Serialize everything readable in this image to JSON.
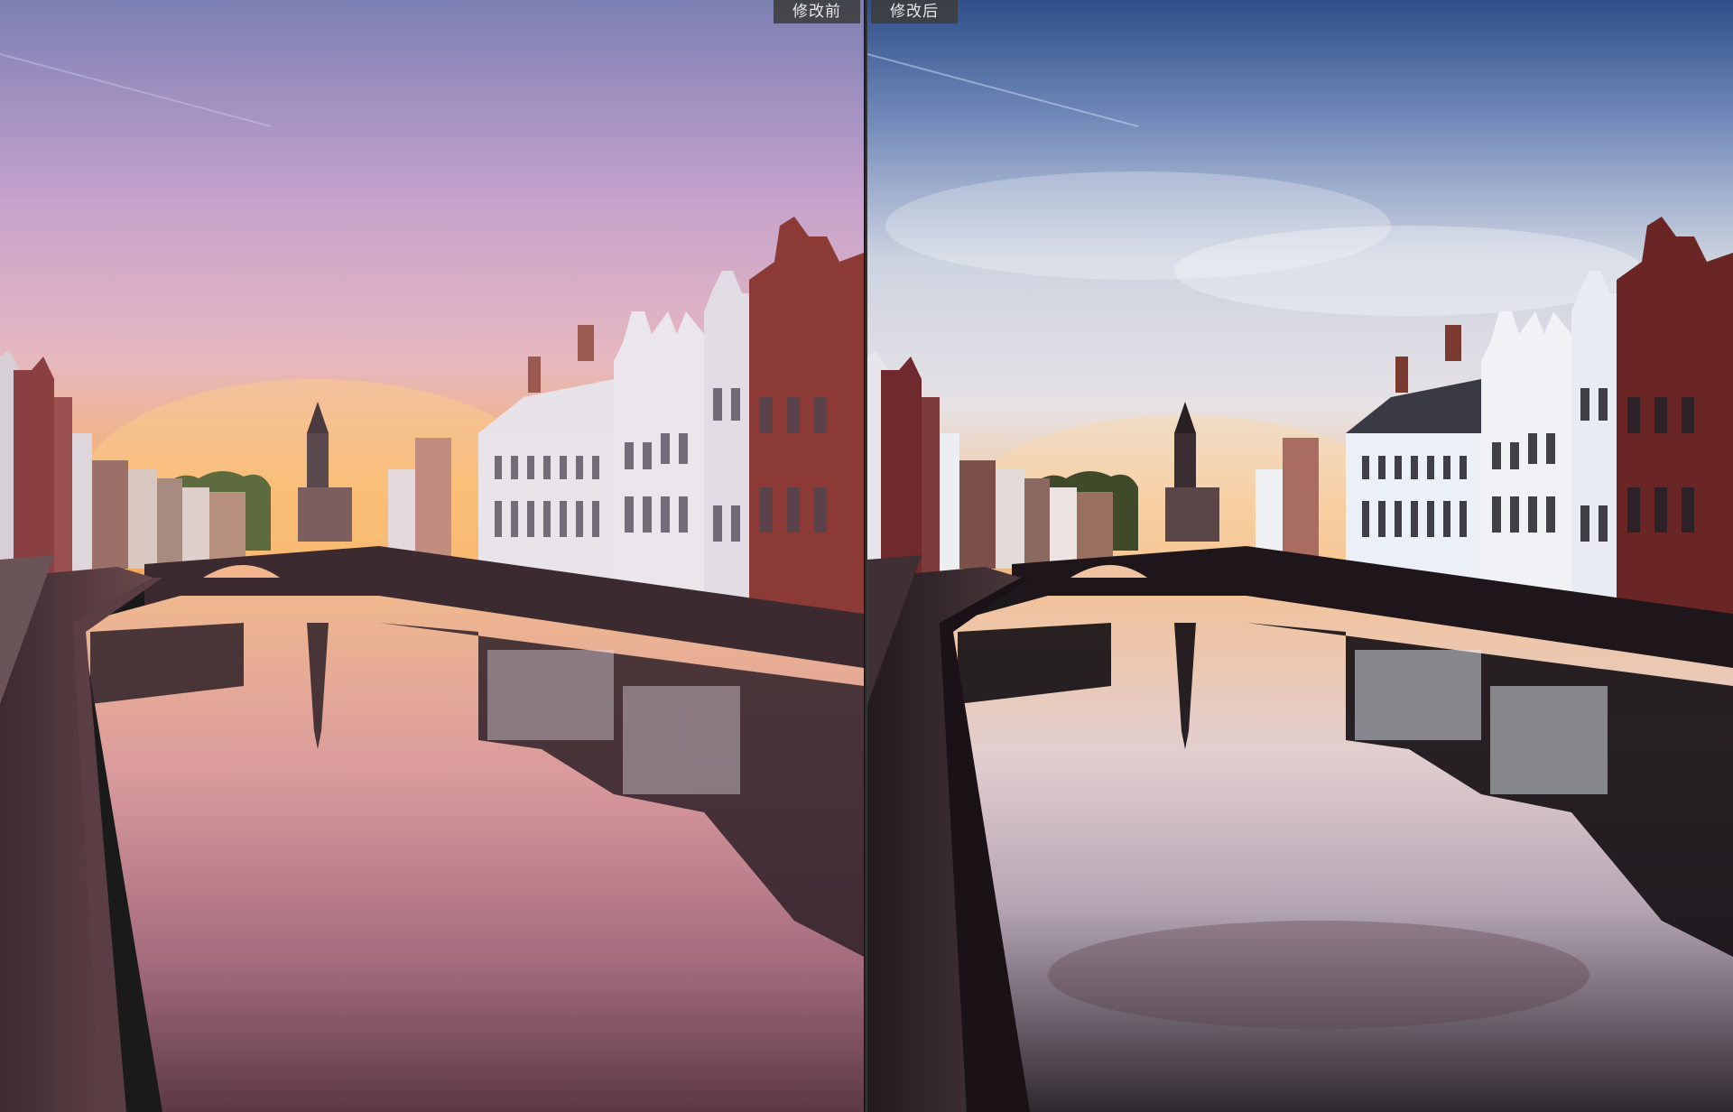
{
  "viewer": {
    "before_label": "修改前",
    "after_label": "修改后"
  },
  "panes": {
    "before": {
      "sky_top": "#7f86b8",
      "sky_mid": "#cfa9cf",
      "sky_glow": "#f3b36b",
      "water_top": "#f1b38e",
      "water_bottom": "#6e4250",
      "building_light": "#e6e2e6",
      "building_brick": "#8c3f3c",
      "shadow": "#2a1c22"
    },
    "after": {
      "sky_top": "#3a5c94",
      "sky_mid": "#d9dde6",
      "sky_glow": "#f0c28a",
      "water_top": "#f1c09a",
      "water_bottom": "#3c2d35",
      "building_light": "#e8eef6",
      "building_brick": "#6a2a28",
      "shadow": "#140f14"
    }
  }
}
